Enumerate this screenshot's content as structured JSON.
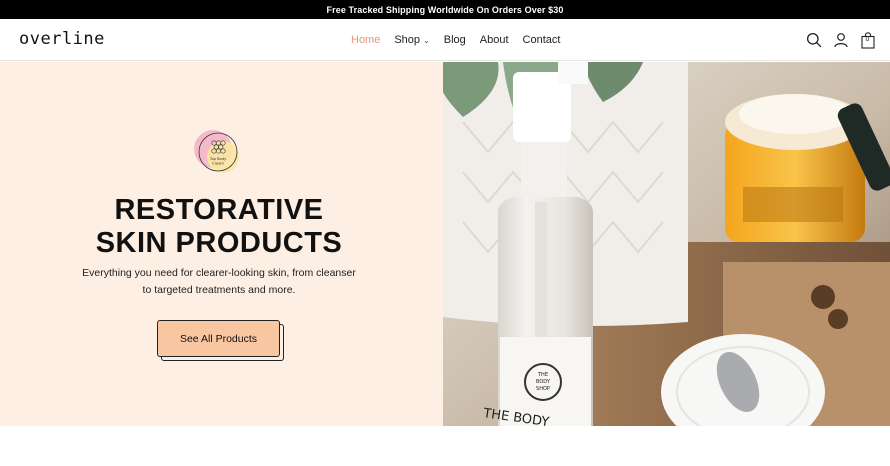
{
  "announcement": "Free Tracked Shipping Worldwide On Orders Over $30",
  "brand": "overline",
  "nav": [
    {
      "label": "Home",
      "active": true
    },
    {
      "label": "Shop",
      "dropdown": true
    },
    {
      "label": "Blog"
    },
    {
      "label": "About"
    },
    {
      "label": "Contact"
    }
  ],
  "header_icons": [
    "search-icon",
    "account-icon",
    "cart-icon"
  ],
  "cart_count": "0",
  "hero": {
    "badge_text_line1": "Top Body",
    "badge_text_line2": "Cream",
    "title_line1": "RESTORATIVE",
    "title_line2": "SKIN PRODUCTS",
    "subtitle_line1": "Everything you need for clearer-looking skin, from cleanser",
    "subtitle_line2": "to targeted treatments and more.",
    "cta_label": "See All Products",
    "image_label_line1": "THE",
    "image_label_line2": "BODY",
    "image_label_line3": "SHOP",
    "image_bottle_text": "THE BODY"
  },
  "colors": {
    "accent": "#e5967a",
    "hero_bg": "#fdefe3",
    "button_bg": "#f9c6a2",
    "announcement_bg": "#000000"
  }
}
